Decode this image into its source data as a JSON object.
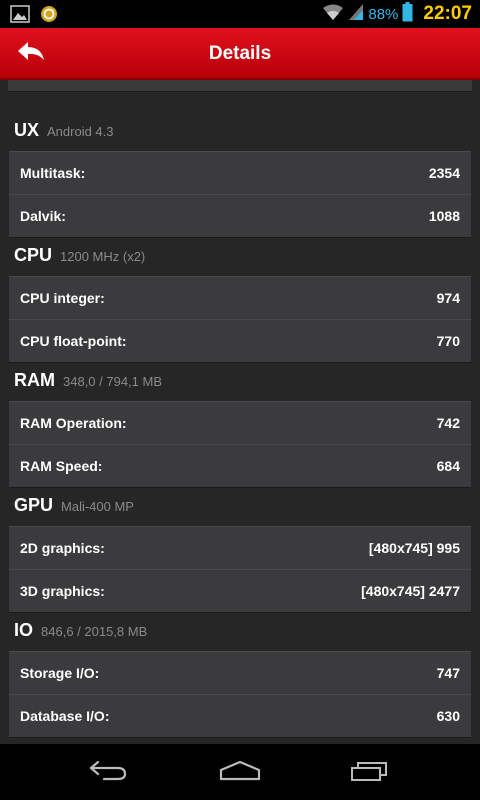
{
  "status_bar": {
    "battery": "88%",
    "time": "22:07",
    "icons": [
      "image-notification-icon",
      "sync-notification-icon",
      "wifi-icon",
      "signal-icon",
      "battery-icon"
    ]
  },
  "action_bar": {
    "title": "Details",
    "back_icon": "back-arrow-icon",
    "color": "#d5000f"
  },
  "sections": [
    {
      "title": "UX",
      "subtitle": "Android 4.3",
      "rows": [
        {
          "label": "Multitask:",
          "value": "2354"
        },
        {
          "label": "Dalvik:",
          "value": "1088"
        }
      ]
    },
    {
      "title": "CPU",
      "subtitle": "1200 MHz (x2)",
      "rows": [
        {
          "label": "CPU integer:",
          "value": "974"
        },
        {
          "label": "CPU float-point:",
          "value": "770"
        }
      ]
    },
    {
      "title": "RAM",
      "subtitle": "348,0 / 794,1 MB",
      "rows": [
        {
          "label": "RAM Operation:",
          "value": "742"
        },
        {
          "label": "RAM Speed:",
          "value": "684"
        }
      ]
    },
    {
      "title": "GPU",
      "subtitle": "Mali-400 MP",
      "rows": [
        {
          "label": "2D graphics:",
          "value": "[480x745] 995"
        },
        {
          "label": "3D graphics:",
          "value": "[480x745] 2477"
        }
      ]
    },
    {
      "title": "IO",
      "subtitle": "846,6 / 2015,8 MB",
      "rows": [
        {
          "label": "Storage I/O:",
          "value": "747"
        },
        {
          "label": "Database I/O:",
          "value": "630"
        }
      ]
    }
  ],
  "nav_bar": {
    "buttons": [
      "back-icon",
      "home-icon",
      "recent-apps-icon"
    ]
  }
}
